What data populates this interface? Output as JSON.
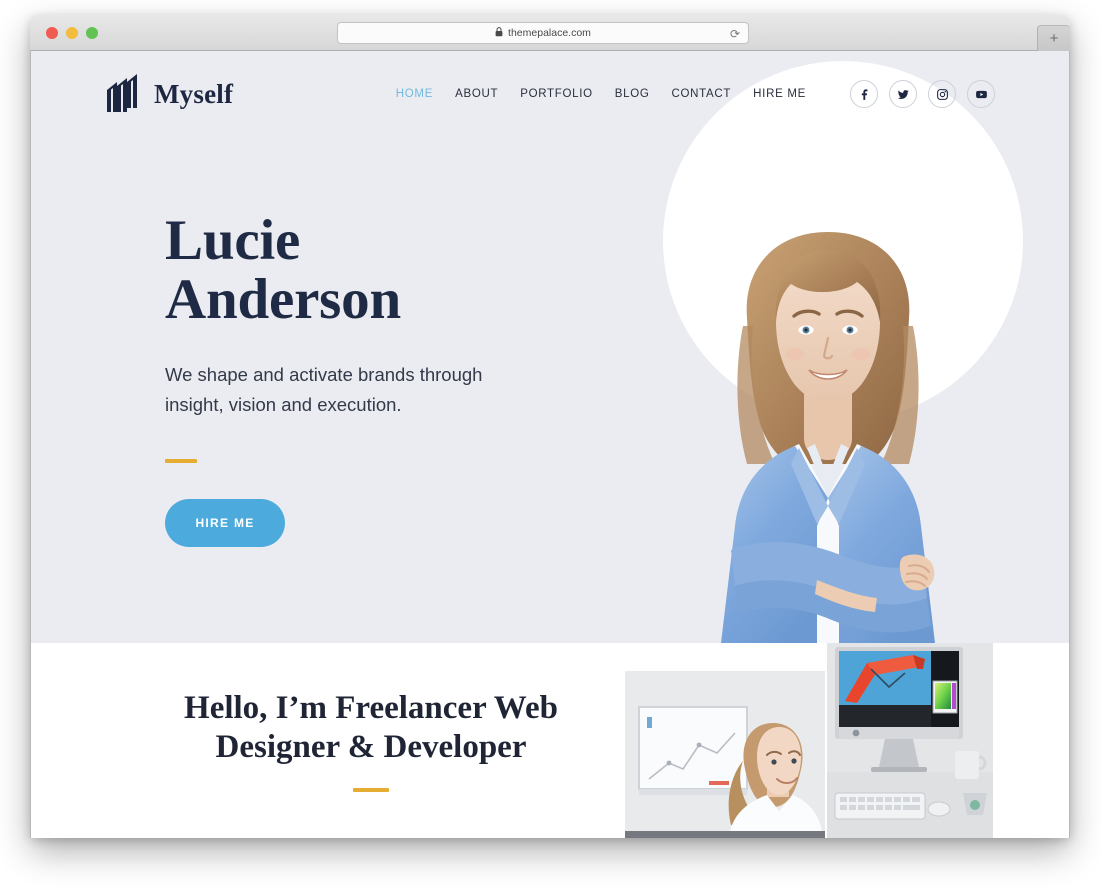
{
  "browser": {
    "url": "themepalace.com",
    "lock_icon": "lock-icon",
    "reload_icon": "reload-icon",
    "new_tab_label": "+",
    "traffic_lights": [
      "close-red",
      "minimize-yellow",
      "maximize-green"
    ]
  },
  "site": {
    "brand": {
      "name": "Myself",
      "logo_icon": "layered-bars-logo"
    },
    "nav": [
      {
        "label": "HOME",
        "active": true
      },
      {
        "label": "ABOUT",
        "active": false
      },
      {
        "label": "PORTFOLIO",
        "active": false
      },
      {
        "label": "BLOG",
        "active": false
      },
      {
        "label": "CONTACT",
        "active": false
      },
      {
        "label": "HIRE ME",
        "active": false
      }
    ],
    "socials": [
      {
        "name": "facebook-icon"
      },
      {
        "name": "twitter-icon"
      },
      {
        "name": "instagram-icon"
      },
      {
        "name": "youtube-icon"
      }
    ],
    "hero": {
      "title_line1": "Lucie",
      "title_line2": "Anderson",
      "subtitle_line1": "We shape and activate brands through",
      "subtitle_line2": "insight, vision and execution.",
      "cta_label": "HIRE ME",
      "portrait_alt": "woman-in-blue-blazer-portrait"
    },
    "about": {
      "title_line1": "Hello, I’m Freelancer Web",
      "title_line2": "Designer & Developer",
      "image_left_alt": "woman-presenting-at-whiteboard",
      "image_right_alt": "imac-desktop-workspace"
    }
  },
  "colors": {
    "hero_background": "#ebecf1",
    "brand_navy": "#1e2742",
    "accent_blue": "#4cabdc",
    "nav_active_blue": "#73b9de",
    "accent_gold": "#e6ad33",
    "page_white": "#ffffff"
  }
}
